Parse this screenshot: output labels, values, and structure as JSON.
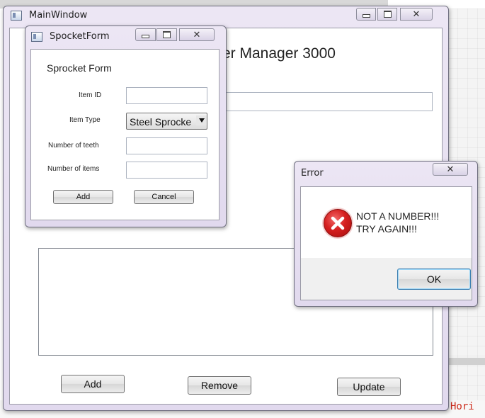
{
  "background": {
    "code_fragment": "Hori",
    "accent_color": "#cc2a1a"
  },
  "main_window": {
    "title": "MainWindow",
    "heading": "er Manager 3000",
    "buttons": {
      "add": "Add",
      "remove": "Remove",
      "update": "Update"
    },
    "controls": {
      "minimize_icon": "minimize-icon",
      "maximize_icon": "maximize-icon",
      "close_glyph": "✕"
    }
  },
  "sprocket_form": {
    "title": "SpocketForm",
    "heading": "Sprocket Form",
    "fields": [
      {
        "label": "Item ID",
        "value": ""
      },
      {
        "label": "Item Type",
        "value": "Steel Sprocke"
      },
      {
        "label": "Number of teeth",
        "value": ""
      },
      {
        "label": "Number of items",
        "value": ""
      }
    ],
    "buttons": {
      "add": "Add",
      "cancel": "Cancel"
    },
    "controls": {
      "close_glyph": "✕"
    }
  },
  "error_dialog": {
    "title": "Error",
    "message_line1": "NOT A NUMBER!!!",
    "message_line2": "TRY AGAIN!!!",
    "ok_label": "OK",
    "icon": "error-icon",
    "icon_color": "#c8102e",
    "controls": {
      "close_glyph": "✕"
    }
  }
}
